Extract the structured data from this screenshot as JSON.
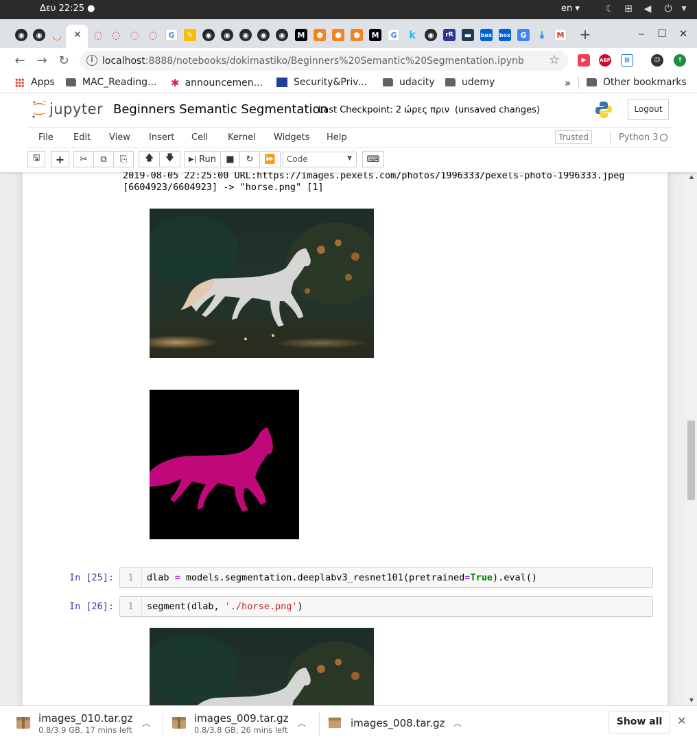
{
  "system": {
    "clock": "Δευ 22:25 ●",
    "language": "en ▾",
    "icons": [
      "moon-icon",
      "network-icon",
      "volume-icon",
      "power-icon"
    ]
  },
  "browser": {
    "tab_icons": [
      "github",
      "github",
      "jupyter",
      "active-close",
      "ring",
      "ring",
      "ring",
      "ring",
      "google",
      "pen",
      "github",
      "github",
      "github",
      "github",
      "github",
      "medium",
      "cube",
      "cube",
      "cube",
      "medium",
      "google",
      "kaggle",
      "github",
      "rr",
      "dark",
      "box",
      "box",
      "translate",
      "download",
      "gmail"
    ],
    "toolbar": {
      "url_host": "localhost",
      "url_path": ":8888/notebooks/dokimastiko/Beginners%20Semantic%20Segmentation.ipynb"
    },
    "extensions": [
      "pocket",
      "ABP",
      "extension",
      "avatar",
      "update"
    ],
    "bookmarks": [
      "Apps",
      "MAC_Reading...",
      "announcemen...",
      "Security&Priv...",
      "udacity",
      "udemy"
    ],
    "bookmarks_overflow": "»",
    "other_bookmarks": "Other bookmarks"
  },
  "jupyter": {
    "logo_text": "jupyter",
    "notebook_title": "Beginners Semantic Segmentation",
    "checkpoint": "Last Checkpoint: 2 ώρες πριν",
    "autosave": "(unsaved changes)",
    "logout": "Logout",
    "menu": [
      "File",
      "Edit",
      "View",
      "Insert",
      "Cell",
      "Kernel",
      "Widgets",
      "Help"
    ],
    "trusted": "Trusted",
    "kernel": "Python 3",
    "toolbar": {
      "run_label": "Run",
      "cell_type": "Code"
    }
  },
  "notebook": {
    "output_lines": [
      "2019-08-05 22:25:00 URL:https://images.pexels.com/photos/1996333/pexels-photo-1996333.jpeg",
      "[6604923/6604923] -> \"horse.png\" [1]"
    ],
    "cells": [
      {
        "prompt": "In [25]:",
        "line": "1",
        "code": {
          "a": "dlab ",
          "op": "=",
          "b": " models.segmentation.deeplabv3_resnet101(pretrained",
          "op2": "=",
          "kw": "True",
          "c": ").eval()"
        }
      },
      {
        "prompt": "In [26]:",
        "line": "1",
        "code": {
          "a": "segment(dlab, ",
          "str": "'./horse.png'",
          "c": ")"
        }
      }
    ]
  },
  "downloads": [
    {
      "name": "images_010.tar.gz",
      "status": "0.8/3.9 GB, 17 mins left"
    },
    {
      "name": "images_009.tar.gz",
      "status": "0.8/3.8 GB, 26 mins left"
    },
    {
      "name": "images_008.tar.gz",
      "status": ""
    }
  ],
  "show_all": "Show all"
}
